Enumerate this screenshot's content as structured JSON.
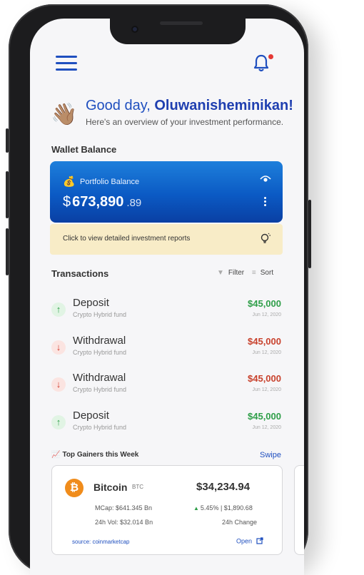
{
  "header": {
    "menu_icon": "hamburger-menu-icon",
    "bell_icon": "bell-icon",
    "accent": "#1f4fbf",
    "notify_color": "#e53935"
  },
  "greeting": {
    "prefix": "Good day,",
    "name": "Oluwanisheminikan!",
    "subtitle": "Here's an overview of your investment performance."
  },
  "wallet": {
    "section_title": "Wallet Balance",
    "label": "Portfolio Balance",
    "currency": "$",
    "amount": "673,890",
    "cents": ".89",
    "visibility_icon": "eye-icon",
    "more_icon": "kebab-menu-icon"
  },
  "report_banner": {
    "text": "Click to view detailed investment reports",
    "bg": "#f8ecc7"
  },
  "transactions": {
    "title": "Transactions",
    "filter_label": "Filter",
    "sort_label": "Sort",
    "items": [
      {
        "type": "Deposit",
        "fund": "Crypto Hybrid fund",
        "amount": "$45,000",
        "date": "Jun 12, 2020",
        "direction": "up"
      },
      {
        "type": "Withdrawal",
        "fund": "Crypto Hybrid fund",
        "amount": "$45,000",
        "date": "Jun 12, 2020",
        "direction": "down"
      },
      {
        "type": "Withdrawal",
        "fund": "Crypto Hybrid fund",
        "amount": "$45,000",
        "date": "Jun 12, 2020",
        "direction": "down"
      },
      {
        "type": "Deposit",
        "fund": "Crypto Hybrid fund",
        "amount": "$45,000",
        "date": "Jun 12, 2020",
        "direction": "up"
      }
    ]
  },
  "gainers": {
    "title": "Top Gainers this Week",
    "swipe_label": "Swipe",
    "coin": {
      "name": "Bitcoin",
      "symbol": "BTC",
      "price": "$34,234.94",
      "mcap": "MCap: $641.345 Bn",
      "volume": "24h Vol: $32.014 Bn",
      "change": "5.45% | $1,890.68",
      "change_label": "24h Change",
      "source": "source: coinmarketcap",
      "open_label": "Open"
    }
  }
}
